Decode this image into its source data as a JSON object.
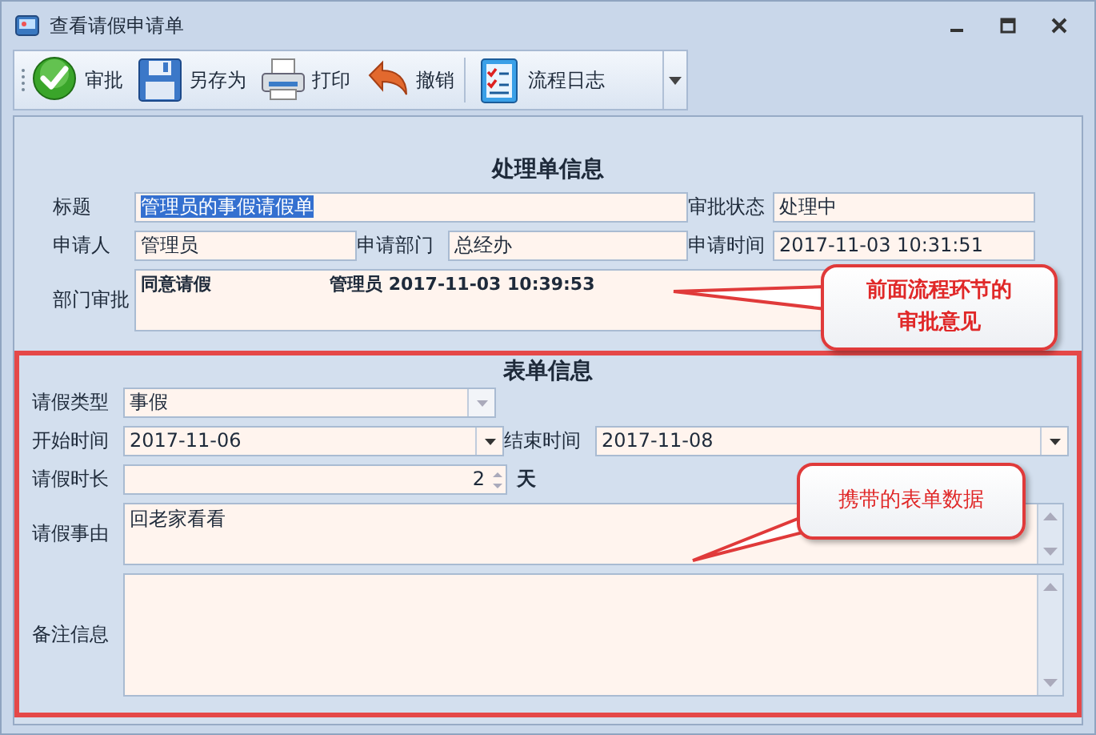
{
  "window": {
    "title": "查看请假申请单"
  },
  "toolbar": [
    {
      "label": "审批"
    },
    {
      "label": "另存为"
    },
    {
      "label": "打印"
    },
    {
      "label": "撤销"
    },
    {
      "label": "流程日志"
    }
  ],
  "process_info": {
    "heading": "处理单信息",
    "title": {
      "label": "标题",
      "value": "管理员的事假请假单",
      "selected": true
    },
    "status": {
      "label": "审批状态",
      "value": "处理中"
    },
    "applicant": {
      "label": "申请人",
      "value": "管理员"
    },
    "department": {
      "label": "申请部门",
      "value": "总经办"
    },
    "apply_time": {
      "label": "申请时间",
      "value": "2017-11-03 10:31:51"
    },
    "dept_approval": {
      "label": "部门审批",
      "opinion": "同意请假",
      "signature": "管理员 2017-11-03 10:39:53"
    }
  },
  "form_info": {
    "heading": "表单信息",
    "leave_type": {
      "label": "请假类型",
      "value": "事假",
      "disabled": true
    },
    "start": {
      "label": "开始时间",
      "value": "2017-11-06",
      "disabled": false
    },
    "end": {
      "label": "结束时间",
      "value": "2017-11-08",
      "disabled": false
    },
    "duration": {
      "label": "请假时长",
      "value": "2",
      "unit": "天"
    },
    "reason": {
      "label": "请假事由",
      "value": "回老家看看"
    },
    "remarks": {
      "label": "备注信息"
    }
  },
  "callouts": [
    {
      "text": "前面流程环节的审批意见",
      "kind": "bold"
    },
    {
      "text": "携带的表单数据",
      "kind": "plain"
    }
  ]
}
